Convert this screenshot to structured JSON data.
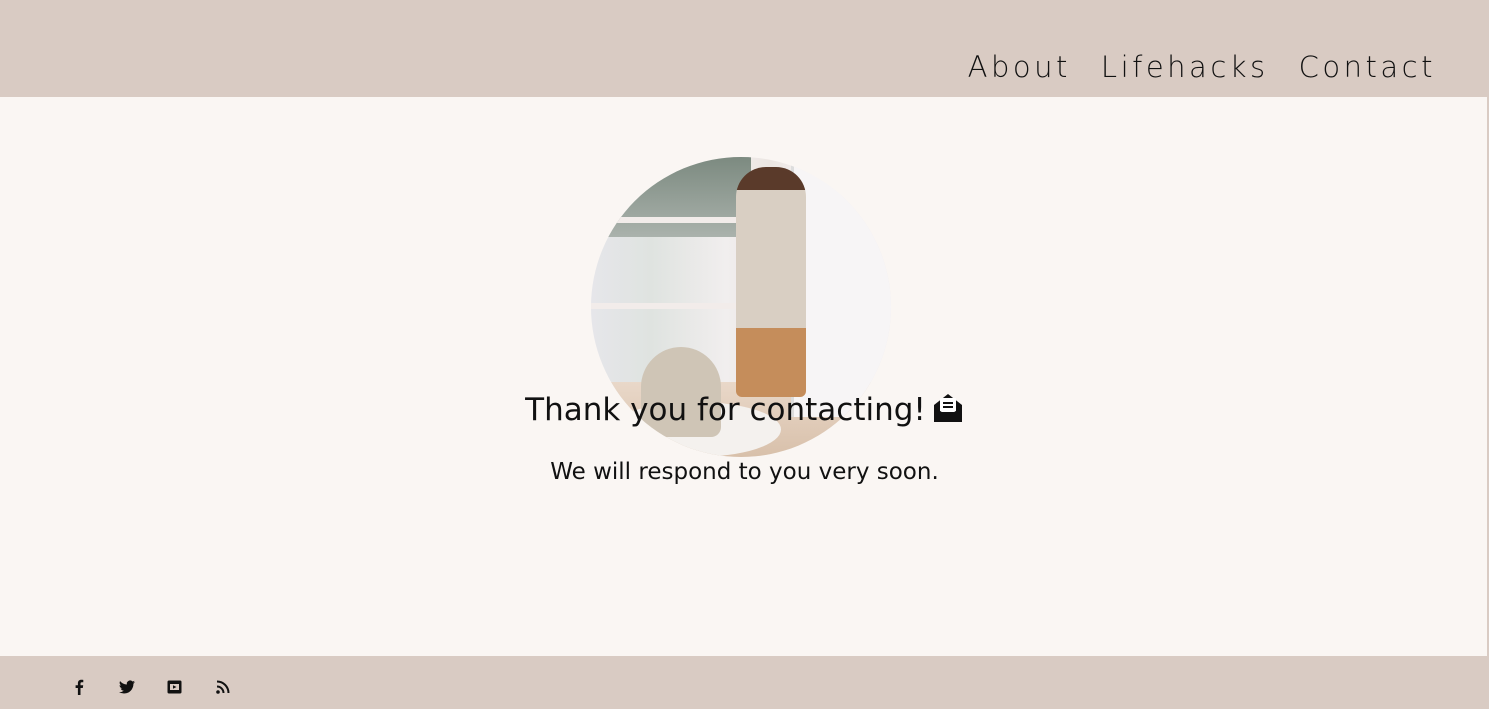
{
  "nav": {
    "items": [
      {
        "label": "About"
      },
      {
        "label": "Lifehacks"
      },
      {
        "label": "Contact"
      }
    ]
  },
  "main": {
    "image": "woman-and-child-photo",
    "title": "Thank you for contacting!",
    "title_icon": "envelope-open-text-icon",
    "subtitle": "We will respond to you very soon."
  },
  "footer": {
    "social": [
      "facebook-icon",
      "twitter-icon",
      "youtube-icon",
      "rss-icon"
    ]
  },
  "colors": {
    "header": "#d9cbc3",
    "background": "#faf6f3",
    "text": "#111111"
  }
}
